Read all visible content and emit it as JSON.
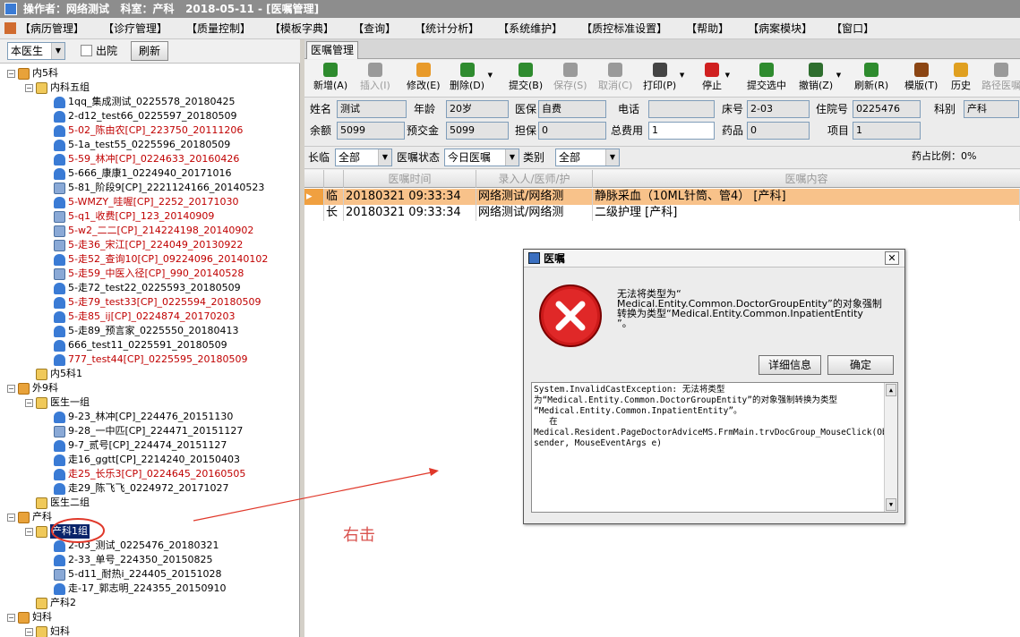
{
  "window": {
    "title": "操作者：网络测试   科室：产科   2018-05-11 - [医嘱管理]"
  },
  "menu": [
    "【病历管理】",
    "【诊疗管理】",
    "【质量控制】",
    "【模板字典】",
    "【查询】",
    "【统计分析】",
    "【系统维护】",
    "【质控标准设置】",
    "【帮助】",
    "【病案模块】",
    "【窗口】"
  ],
  "left_panel": {
    "doctor_filter": "本医生",
    "discharged_label": "出院",
    "refresh_label": "刷新"
  },
  "tree": [
    {
      "label": "内5科",
      "level": 0,
      "type": "dept",
      "exp": "-"
    },
    {
      "label": "内科五组",
      "level": 1,
      "type": "grp",
      "exp": "-"
    },
    {
      "label": "1qq_集成测试_0225578_20180425",
      "level": 2,
      "type": "pat",
      "color": "black"
    },
    {
      "label": "2-d12_test66_0225597_20180509",
      "level": 2,
      "type": "pat",
      "color": "black"
    },
    {
      "label": "5-02_陈由农[CP]_223750_20111206",
      "level": 2,
      "type": "pat",
      "color": "red"
    },
    {
      "label": "5-1a_test55_0225596_20180509",
      "level": 2,
      "type": "pat",
      "color": "black"
    },
    {
      "label": "5-59_林冲[CP]_0224633_20160426",
      "level": 2,
      "type": "pat",
      "color": "red"
    },
    {
      "label": "5-666_康康1_0224940_20171016",
      "level": 2,
      "type": "pat",
      "color": "black"
    },
    {
      "label": "5-81_阶段9[CP]_2221124166_20140523",
      "level": 2,
      "type": "bed",
      "color": "black"
    },
    {
      "label": "5-WMZY_哇喔[CP]_2252_20171030",
      "level": 2,
      "type": "pat",
      "color": "red"
    },
    {
      "label": "5-q1_收费[CP]_123_20140909",
      "level": 2,
      "type": "bed",
      "color": "red"
    },
    {
      "label": "5-w2_二二[CP]_214224198_20140902",
      "level": 2,
      "type": "bed",
      "color": "red"
    },
    {
      "label": "5-走36_宋江[CP]_224049_20130922",
      "level": 2,
      "type": "bed",
      "color": "red"
    },
    {
      "label": "5-走52_查询10[CP]_09224096_20140102",
      "level": 2,
      "type": "pat",
      "color": "red"
    },
    {
      "label": "5-走59_中医入径[CP]_990_20140528",
      "level": 2,
      "type": "bed",
      "color": "red"
    },
    {
      "label": "5-走72_test22_0225593_20180509",
      "level": 2,
      "type": "pat",
      "color": "black"
    },
    {
      "label": "5-走79_test33[CP]_0225594_20180509",
      "level": 2,
      "type": "pat",
      "color": "red"
    },
    {
      "label": "5-走85_ij[CP]_0224874_20170203",
      "level": 2,
      "type": "pat",
      "color": "red"
    },
    {
      "label": "5-走89_预言家_0225550_20180413",
      "level": 2,
      "type": "pat",
      "color": "black"
    },
    {
      "label": "666_test11_0225591_20180509",
      "level": 2,
      "type": "pat",
      "color": "black"
    },
    {
      "label": "777_test44[CP]_0225595_20180509",
      "level": 2,
      "type": "pat",
      "color": "red"
    },
    {
      "label": "内5科1",
      "level": 1,
      "type": "grp",
      "exp": ""
    },
    {
      "label": "外9科",
      "level": 0,
      "type": "dept",
      "exp": "-"
    },
    {
      "label": "医生一组",
      "level": 1,
      "type": "grp",
      "exp": "-"
    },
    {
      "label": "9-23_林冲[CP]_224476_20151130",
      "level": 2,
      "type": "pat",
      "color": "black"
    },
    {
      "label": "9-28_一中匹[CP]_224471_20151127",
      "level": 2,
      "type": "bed",
      "color": "black"
    },
    {
      "label": "9-7_贰号[CP]_224474_20151127",
      "level": 2,
      "type": "pat",
      "color": "black"
    },
    {
      "label": "走16_ggtt[CP]_2214240_20150403",
      "level": 2,
      "type": "pat",
      "color": "black"
    },
    {
      "label": "走25_长乐3[CP]_0224645_20160505",
      "level": 2,
      "type": "pat",
      "color": "red"
    },
    {
      "label": "走29_陈飞飞_0224972_20171027",
      "level": 2,
      "type": "pat",
      "color": "black"
    },
    {
      "label": "医生二组",
      "level": 1,
      "type": "grp",
      "exp": ""
    },
    {
      "label": "产科",
      "level": 0,
      "type": "dept",
      "exp": "-"
    },
    {
      "label": "产科1组",
      "level": 1,
      "type": "grp",
      "exp": "-",
      "selected": true
    },
    {
      "label": "2-03_测试_0225476_20180321",
      "level": 2,
      "type": "pat",
      "color": "black"
    },
    {
      "label": "2-33_单号_224350_20150825",
      "level": 2,
      "type": "pat",
      "color": "black"
    },
    {
      "label": "5-d11_耐热i_224405_20151028",
      "level": 2,
      "type": "bed",
      "color": "black"
    },
    {
      "label": "走-17_郭志明_224355_20150910",
      "level": 2,
      "type": "pat",
      "color": "black"
    },
    {
      "label": "产科2",
      "level": 1,
      "type": "grp",
      "exp": ""
    },
    {
      "label": "妇科",
      "level": 0,
      "type": "dept",
      "exp": "-"
    },
    {
      "label": "妇科",
      "level": 1,
      "type": "grp",
      "exp": "-"
    }
  ],
  "tab": {
    "label": "医嘱管理"
  },
  "toolbar": [
    {
      "label": "新增(A)",
      "icon": "plus-circle-icon",
      "color": "#2e8b2e",
      "disabled": false,
      "dd": false
    },
    {
      "label": "插入(I)",
      "icon": "insert-icon",
      "color": "#9a9a9a",
      "disabled": true,
      "dd": false
    },
    {
      "label": "修改(E)",
      "icon": "edit-icon",
      "color": "#e89a2a",
      "disabled": false,
      "dd": false
    },
    {
      "label": "删除(D)",
      "icon": "minus-circle-icon",
      "color": "#2e8b2e",
      "disabled": false,
      "dd": true
    },
    {
      "label": "提交(B)",
      "icon": "check-icon",
      "color": "#2e8b2e",
      "disabled": false,
      "dd": false
    },
    {
      "label": "保存(S)",
      "icon": "save-icon",
      "color": "#9a9a9a",
      "disabled": true,
      "dd": false
    },
    {
      "label": "取消(C)",
      "icon": "undo-icon",
      "color": "#9a9a9a",
      "disabled": true,
      "dd": false
    },
    {
      "label": "打印(P)",
      "icon": "printer-icon",
      "color": "#444444",
      "disabled": false,
      "dd": true
    },
    {
      "label": "停止",
      "icon": "stop-icon",
      "color": "#d02020",
      "disabled": false,
      "dd": true
    },
    {
      "label": "提交选中",
      "icon": "check-selected-icon",
      "color": "#2e8b2e",
      "disabled": false,
      "dd": false
    },
    {
      "label": "撤销(Z)",
      "icon": "trash-icon",
      "color": "#2e6e2e",
      "disabled": false,
      "dd": true
    },
    {
      "label": "刷新(R)",
      "icon": "refresh-icon",
      "color": "#2e8b2e",
      "disabled": false,
      "dd": false
    },
    {
      "label": "模版(T)",
      "icon": "template-icon",
      "color": "#8b4513",
      "disabled": false,
      "dd": false
    },
    {
      "label": "历史",
      "icon": "history-icon",
      "color": "#e0a020",
      "disabled": false,
      "dd": false
    },
    {
      "label": "路径医嘱",
      "icon": "path-icon",
      "color": "#9a9a9a",
      "disabled": true,
      "dd": false
    }
  ],
  "patient": {
    "name_label": "姓名",
    "name": "测试",
    "age_label": "年龄",
    "age": "20岁",
    "insurance_label": "医保",
    "insurance": "自费",
    "phone_label": "电话",
    "phone": "",
    "bed_label": "床号",
    "bed": "2-03",
    "inpatient_label": "住院号",
    "inpatient_no": "0225476",
    "dept_label": "科别",
    "dept": "产科",
    "balance_label": "余额",
    "balance": "5099",
    "deposit_label": "预交金",
    "deposit": "5099",
    "guarantee_label": "担保",
    "guarantee": "0",
    "total_label": "总费用",
    "total": "1",
    "drug_label": "药品",
    "drug": "0",
    "item_label": "项目",
    "item": "1"
  },
  "filter": {
    "duration_label": "长临",
    "duration": "全部",
    "status_label": "医嘱状态",
    "status": "今日医嘱",
    "category_label": "类别",
    "category": "全部",
    "drug_ratio": "药占比例：0%"
  },
  "grid": {
    "headers": [
      "医嘱时间",
      "录入人/医师/护",
      "医嘱内容"
    ],
    "rows": [
      {
        "type": "临",
        "time": "20180321 09:33:34",
        "person": "网络测试/网络测",
        "content": "静脉采血（10ML针筒、管4）    [产科]",
        "selected": true
      },
      {
        "type": "长",
        "time": "20180321 09:33:34",
        "person": "网络测试/网络测",
        "content": "二级护理    [产科]",
        "selected": false
      }
    ]
  },
  "dialog": {
    "title": "医嘱",
    "message": "无法将类型为“\nMedical.Entity.Common.DoctorGroupEntity”的对象强制\n转换为类型“Medical.Entity.Common.InpatientEntity\n”。",
    "details_button": "详细信息",
    "ok_button": "确定",
    "detail_text": "System.InvalidCastException: 无法将类型\n为“Medical.Entity.Common.DoctorGroupEntity”的对象强制转换为类型\n“Medical.Entity.Common.InpatientEntity”。\n   在\nMedical.Resident.PageDoctorAdviceMS.FrmMain.trvDocGroup_MouseClick(Object sender, MouseEventArgs e)"
  },
  "annotation": {
    "text": "右击",
    "color": "#d9534f"
  }
}
